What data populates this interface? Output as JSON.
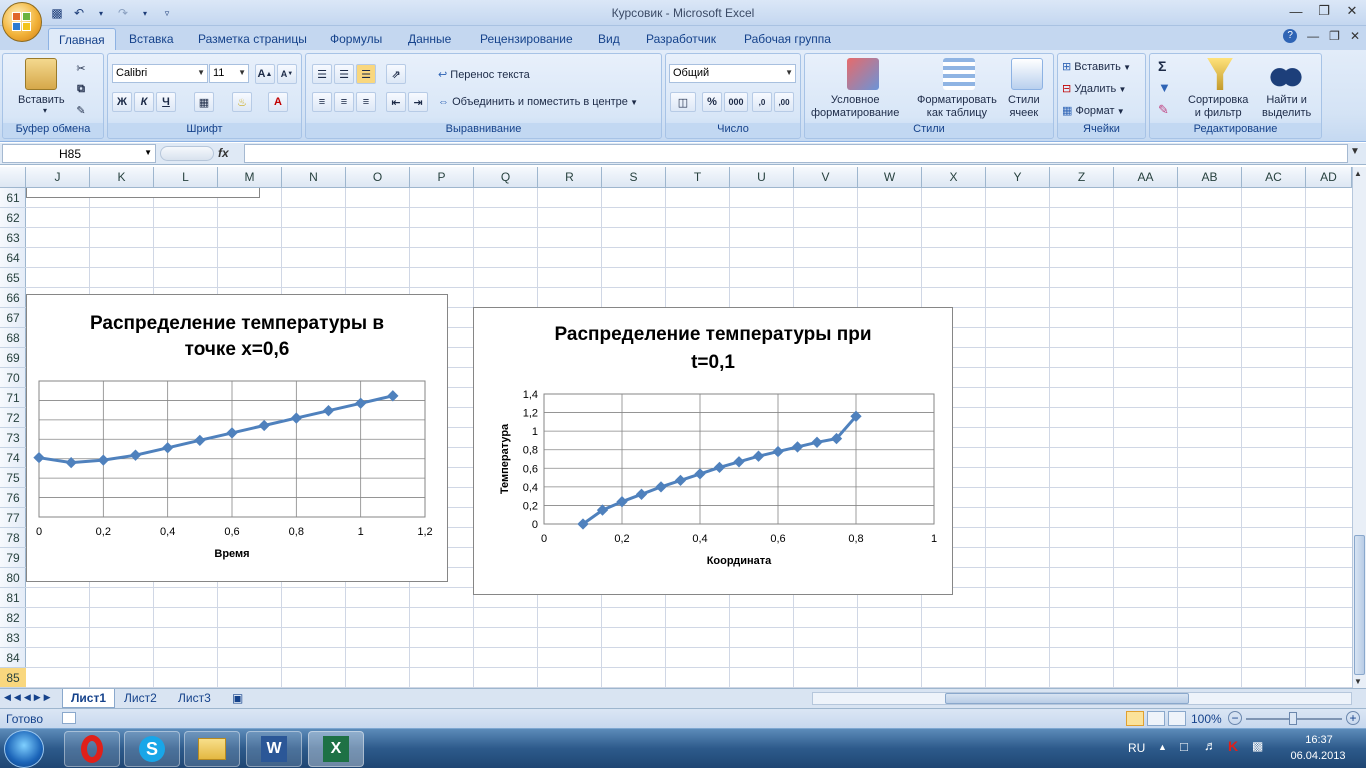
{
  "window": {
    "title": "Курсовик - Microsoft Excel"
  },
  "ribbon": {
    "tabs": [
      "Главная",
      "Вставка",
      "Разметка страницы",
      "Формулы",
      "Данные",
      "Рецензирование",
      "Вид",
      "Разработчик",
      "Рабочая группа"
    ],
    "active_tab": "Главная",
    "clipboard": {
      "paste": "Вставить",
      "label": "Буфер обмена"
    },
    "font": {
      "name": "Calibri",
      "size": "11",
      "bold": "Ж",
      "italic": "К",
      "underline": "Ч",
      "label": "Шрифт"
    },
    "alignment": {
      "wrap": "Перенос текста",
      "merge": "Объединить и поместить в центре",
      "label": "Выравнивание"
    },
    "number": {
      "format": "Общий",
      "percent": "%",
      "thousands": "000",
      "label": "Число"
    },
    "styles": {
      "conditional": [
        "Условное",
        "форматирование"
      ],
      "table": [
        "Форматировать",
        "как таблицу"
      ],
      "cell": [
        "Стили",
        "ячеек"
      ],
      "label": "Стили"
    },
    "cells": {
      "insert": "Вставить",
      "delete": "Удалить",
      "format": "Формат",
      "label": "Ячейки"
    },
    "editing": {
      "sort": [
        "Сортировка",
        "и фильтр"
      ],
      "find": [
        "Найти и",
        "выделить"
      ],
      "label": "Редактирование"
    }
  },
  "formula_bar": {
    "name_box": "H85",
    "fx": "fx",
    "value": ""
  },
  "columns": [
    "J",
    "K",
    "L",
    "M",
    "N",
    "O",
    "P",
    "Q",
    "R",
    "S",
    "T",
    "U",
    "V",
    "W",
    "X",
    "Y",
    "Z",
    "AA",
    "AB",
    "AC",
    "AD"
  ],
  "rows": [
    "61",
    "62",
    "63",
    "64",
    "65",
    "66",
    "67",
    "68",
    "69",
    "70",
    "71",
    "72",
    "73",
    "74",
    "75",
    "76",
    "77",
    "78",
    "79",
    "80",
    "81",
    "82",
    "83",
    "84",
    "85"
  ],
  "sheets": [
    "Лист1",
    "Лист2",
    "Лист3"
  ],
  "active_sheet": "Лист1",
  "status": {
    "ready": "Готово",
    "zoom": "100%"
  },
  "taskbar": {
    "lang": "RU",
    "time": "16:37",
    "date": "06.04.2013"
  },
  "chart_data": [
    {
      "type": "line",
      "title_lines": [
        "Распределение температуры в",
        "точке x=0,6"
      ],
      "xlabel": "Время",
      "ylabel": "",
      "xlim": [
        0,
        1.2
      ],
      "x_ticks": [
        "0",
        "0,2",
        "0,4",
        "0,6",
        "0,8",
        "1",
        "1,2"
      ],
      "x": [
        0,
        0.1,
        0.2,
        0.3,
        0.4,
        0.5,
        0.6,
        0.7,
        0.8,
        0.9,
        1.0,
        1.1
      ],
      "y": [
        0.59,
        0.57,
        0.58,
        0.6,
        0.63,
        0.66,
        0.69,
        0.72,
        0.75,
        0.78,
        0.81,
        0.84
      ],
      "ylim": [
        0.35,
        0.9
      ],
      "grid": true,
      "color": "#4f81bd"
    },
    {
      "type": "line",
      "title_lines": [
        "Распределение температуры при",
        "t=0,1"
      ],
      "xlabel": "Координата",
      "ylabel": "Температура",
      "xlim": [
        0,
        1
      ],
      "ylim": [
        0,
        1.4
      ],
      "x_ticks": [
        "0",
        "0,2",
        "0,4",
        "0,6",
        "0,8",
        "1"
      ],
      "y_ticks": [
        "0",
        "0,2",
        "0,4",
        "0,6",
        "0,8",
        "1",
        "1,2",
        "1,4"
      ],
      "x": [
        0.1,
        0.15,
        0.2,
        0.25,
        0.3,
        0.35,
        0.4,
        0.45,
        0.5,
        0.55,
        0.6,
        0.65,
        0.7,
        0.75,
        0.8
      ],
      "y": [
        0,
        0.15,
        0.24,
        0.32,
        0.4,
        0.47,
        0.54,
        0.61,
        0.67,
        0.73,
        0.78,
        0.83,
        0.88,
        0.92,
        1.16
      ],
      "grid": true,
      "color": "#4f81bd"
    }
  ]
}
